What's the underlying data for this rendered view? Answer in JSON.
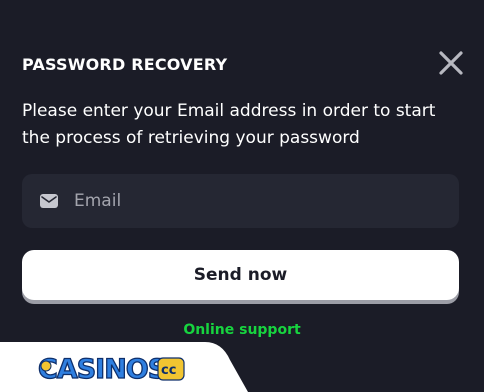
{
  "modal": {
    "title": "PASSWORD RECOVERY",
    "description": "Please enter your Email address in order to start the process of retrieving your password",
    "email_field": {
      "placeholder": "Email",
      "value": ""
    },
    "send_button_label": "Send now",
    "support_link_label": "Online support"
  },
  "icons": {
    "close": "close-icon",
    "mail": "mail-icon"
  },
  "watermark": {
    "text": "CASINOS.cc"
  },
  "colors": {
    "background": "#1b1c27",
    "input_bg": "#252733",
    "link_green": "#17d43f",
    "button_bg": "#ffffff"
  }
}
